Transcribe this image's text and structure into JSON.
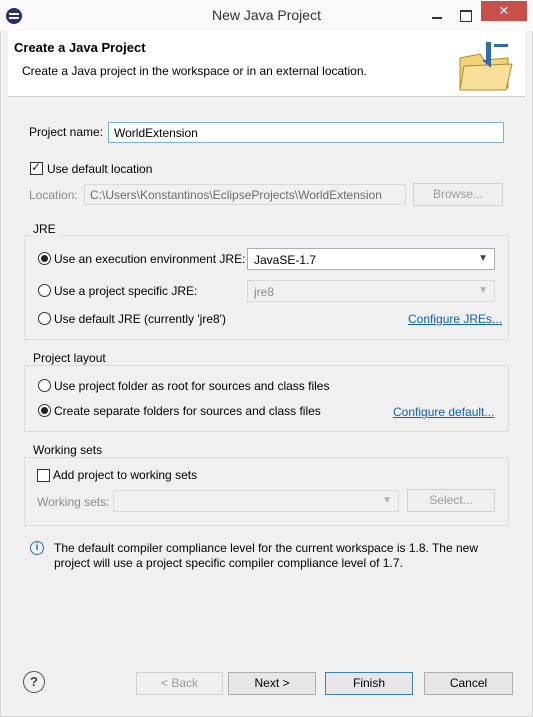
{
  "window": {
    "title": "New Java Project",
    "close_glyph": "✕"
  },
  "banner": {
    "title": "Create a Java Project",
    "description": "Create a Java project in the workspace or in an external location."
  },
  "project": {
    "name_label": "Project name:",
    "name_value": "WorldExtension",
    "use_default_location_label": "Use default location",
    "use_default_location_checked": true,
    "location_label": "Location:",
    "location_value": "C:\\Users\\Konstantinos\\EclipseProjects\\WorldExtension",
    "browse_label": "Browse..."
  },
  "jre": {
    "group_title": "JRE",
    "option_env_label": "Use an execution environment JRE:",
    "option_env_value": "JavaSE-1.7",
    "option_specific_label": "Use a project specific JRE:",
    "option_specific_value": "jre8",
    "option_default_label": "Use default JRE (currently 'jre8')",
    "configure_link": "Configure JREs...",
    "selected": "env"
  },
  "layout": {
    "group_title": "Project layout",
    "option_root_label": "Use project folder as root for sources and class files",
    "option_separate_label": "Create separate folders for sources and class files",
    "configure_link": "Configure default...",
    "selected": "separate"
  },
  "working_sets": {
    "group_title": "Working sets",
    "add_label": "Add project to working sets",
    "add_checked": false,
    "sets_label": "Working sets:",
    "sets_value": "",
    "select_label": "Select..."
  },
  "info": {
    "icon": "info-icon",
    "line1": "The default compiler compliance level for the current workspace is 1.8. The new",
    "line2": "project will use a project specific compiler compliance level of 1.7."
  },
  "footer": {
    "help_glyph": "?",
    "back_label": "< Back",
    "next_label": "Next >",
    "finish_label": "Finish",
    "cancel_label": "Cancel"
  },
  "colors": {
    "accent_link": "#0d63b5",
    "close_button": "#c7504b",
    "default_button_border": "#3c7fb1"
  }
}
